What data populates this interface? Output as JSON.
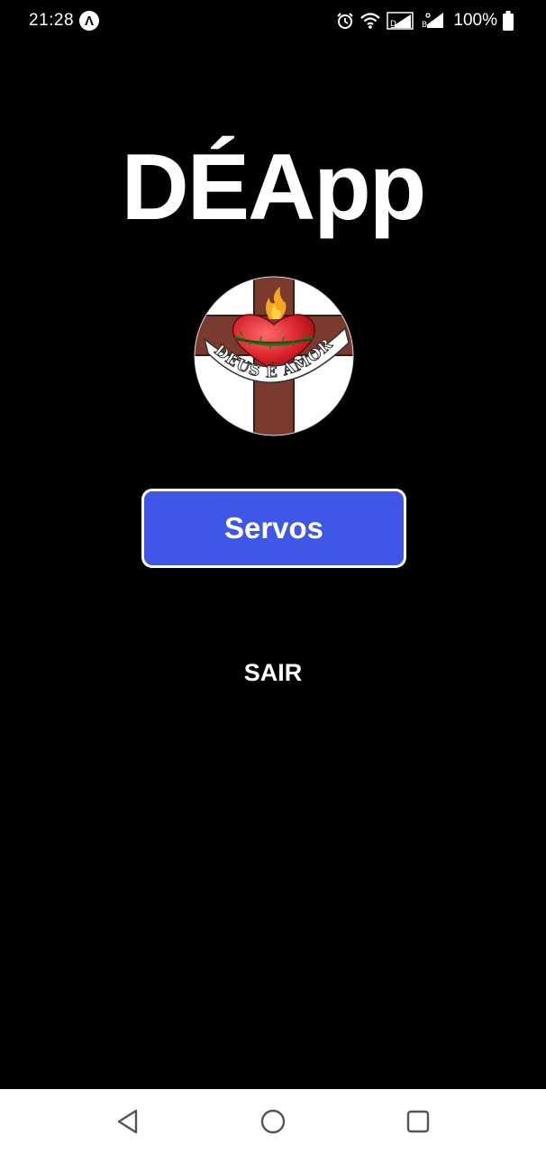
{
  "status_bar": {
    "time": "21:28",
    "app_icon_glyph": "Λ",
    "battery_percent": "100%"
  },
  "app": {
    "title": "DÉApp"
  },
  "logo": {
    "banner_text": "DEUS É AMOR"
  },
  "actions": {
    "servos_label": "Servos",
    "sair_label": "SAIR"
  },
  "colors": {
    "background": "#000000",
    "button": "#3f57e6",
    "cross": "#7a3b2e",
    "heart": "#d8232a",
    "nav_bar": "#ffffff"
  },
  "icons": {
    "status": [
      "notification-app-icon",
      "alarm-icon",
      "wifi-icon",
      "signal-icon",
      "signal-icon-2",
      "battery-icon"
    ],
    "nav": [
      "back-icon",
      "home-icon",
      "recent-apps-icon"
    ]
  }
}
